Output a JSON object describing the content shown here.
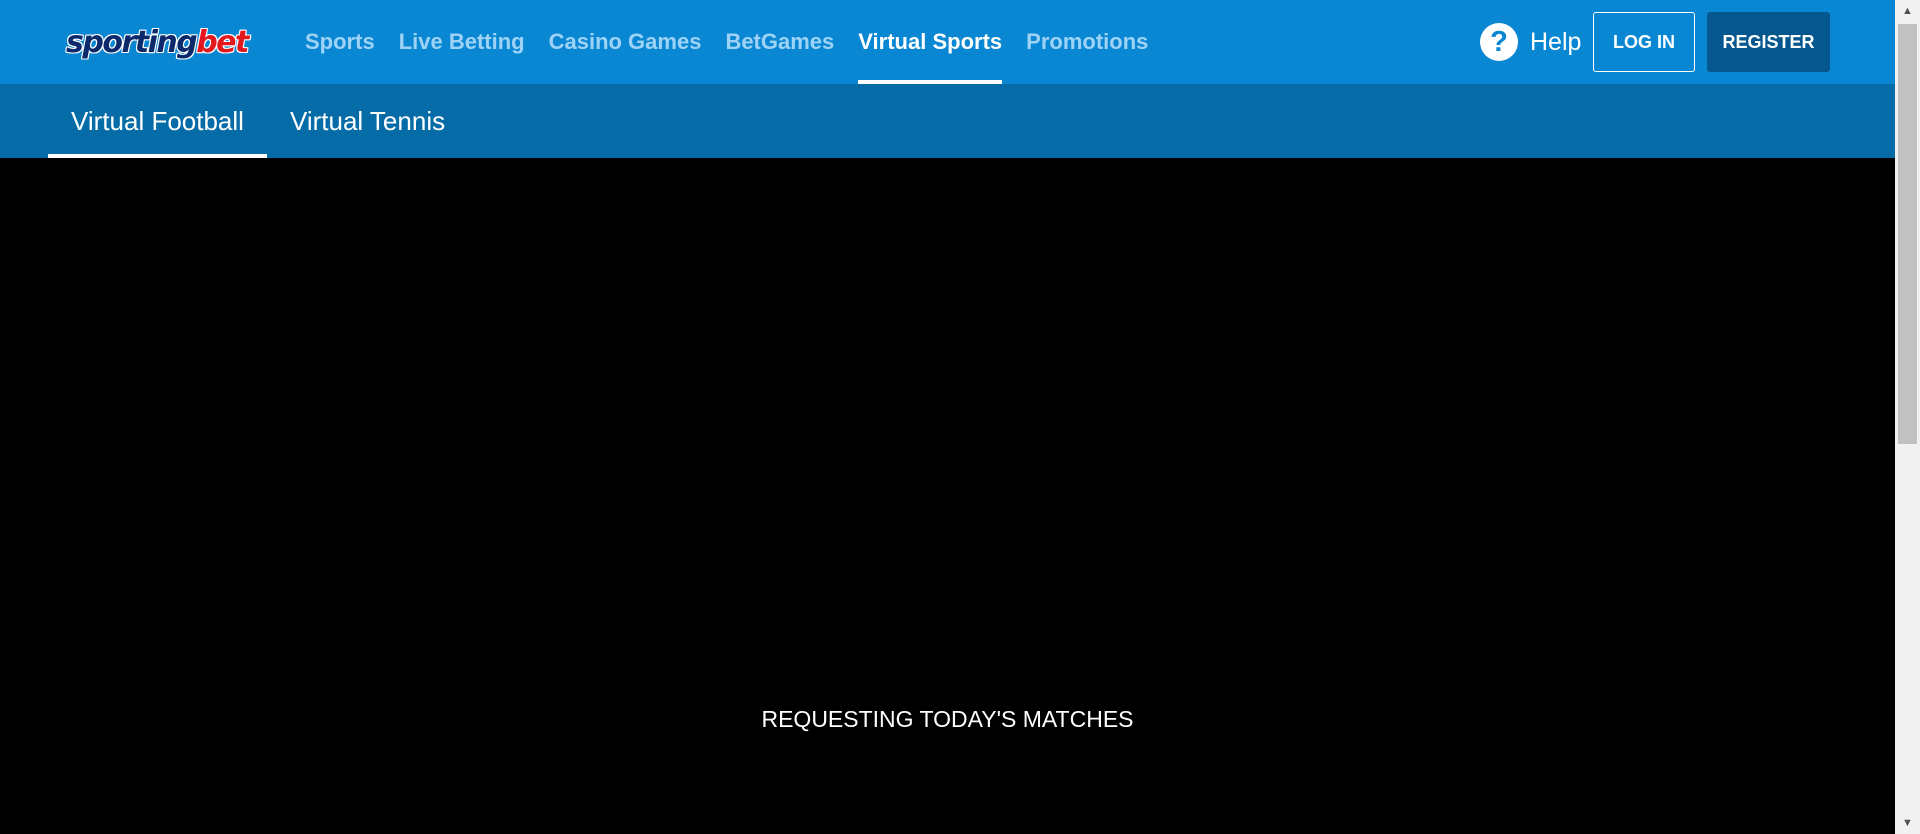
{
  "header": {
    "logo_part1": "sporting",
    "logo_part2": "bet",
    "nav": [
      {
        "label": "Sports"
      },
      {
        "label": "Live Betting"
      },
      {
        "label": "Casino Games"
      },
      {
        "label": "BetGames"
      },
      {
        "label": "Virtual Sports",
        "active": true
      },
      {
        "label": "Promotions"
      }
    ],
    "help_icon_glyph": "?",
    "help_label": "Help",
    "login_label": "LOG IN",
    "register_label": "REGISTER"
  },
  "subnav": [
    {
      "label": "Virtual Football",
      "active": true
    },
    {
      "label": "Virtual Tennis"
    }
  ],
  "game": {
    "status_text": "REQUESTING TODAY'S MATCHES"
  },
  "scrollbar": {
    "up_glyph": "▲",
    "down_glyph": "▼"
  },
  "colors": {
    "header_bg": "#0a87d3",
    "subheader_bg": "#066ca8",
    "register_bg": "#05578f",
    "nav_inactive": "#9fd3f6",
    "logo_blue": "#0c2a6b",
    "logo_red": "#e3181f"
  },
  "icons": {
    "help": "question-circle-icon",
    "scroll_up": "arrow-up-icon",
    "scroll_down": "arrow-down-icon"
  }
}
